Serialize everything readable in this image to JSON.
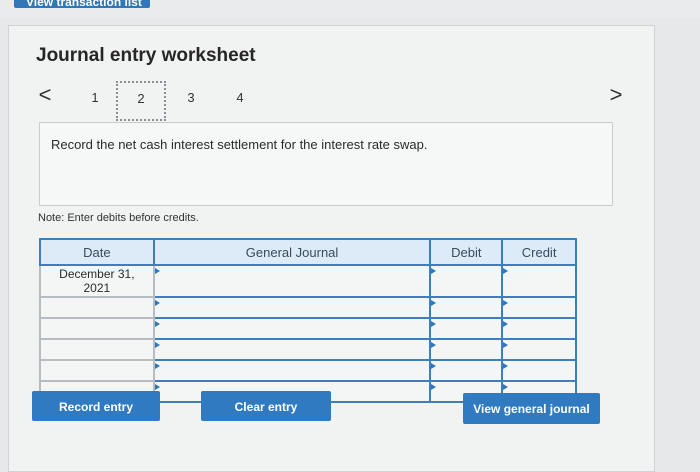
{
  "top": {
    "button_label": "View transaction list"
  },
  "worksheet": {
    "title": "Journal entry worksheet",
    "steps": [
      "1",
      "2",
      "3",
      "4"
    ],
    "active_step": "2",
    "prev_icon": "<",
    "next_icon": ">",
    "instruction": "Record the net cash interest settlement for the interest rate swap.",
    "note": "Note: Enter debits before credits."
  },
  "table": {
    "headers": {
      "date": "Date",
      "journal": "General Journal",
      "debit": "Debit",
      "credit": "Credit"
    },
    "rows": [
      {
        "date": "December 31,\n2021",
        "journal": "",
        "debit": "",
        "credit": ""
      },
      {
        "date": "",
        "journal": "",
        "debit": "",
        "credit": ""
      },
      {
        "date": "",
        "journal": "",
        "debit": "",
        "credit": ""
      },
      {
        "date": "",
        "journal": "",
        "debit": "",
        "credit": ""
      },
      {
        "date": "",
        "journal": "",
        "debit": "",
        "credit": ""
      },
      {
        "date": "",
        "journal": "",
        "debit": "",
        "credit": ""
      }
    ]
  },
  "buttons": {
    "record": "Record entry",
    "clear": "Clear entry",
    "view": "View general journal"
  },
  "colors": {
    "accent": "#2f7ac0",
    "table_border": "#3f7dbd",
    "header_bg": "#dcebf7"
  }
}
